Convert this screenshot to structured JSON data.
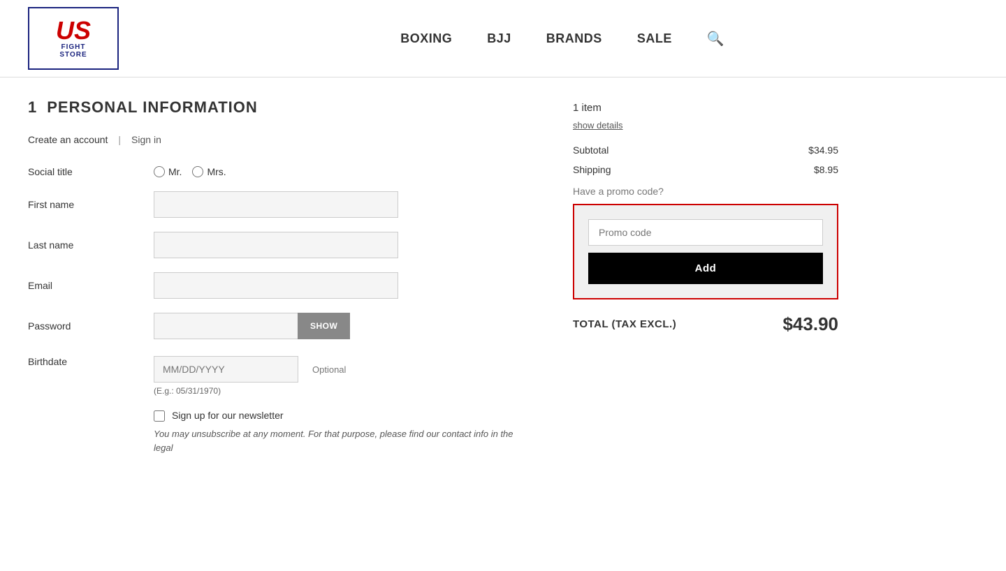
{
  "header": {
    "logo": {
      "us_text": "US",
      "fight_text": "FIGHT",
      "store_text": "STORE"
    },
    "nav": {
      "items": [
        {
          "label": "BOXING",
          "key": "boxing"
        },
        {
          "label": "BJJ",
          "key": "bjj"
        },
        {
          "label": "BRANDS",
          "key": "brands"
        },
        {
          "label": "SALE",
          "key": "sale"
        }
      ]
    }
  },
  "form": {
    "step_number": "1",
    "step_title": "PERSONAL INFORMATION",
    "create_account_label": "Create an account",
    "sign_in_label": "Sign in",
    "social_title_label": "Social title",
    "mr_label": "Mr.",
    "mrs_label": "Mrs.",
    "first_name_label": "First name",
    "first_name_placeholder": "",
    "last_name_label": "Last name",
    "last_name_placeholder": "",
    "email_label": "Email",
    "email_placeholder": "",
    "password_label": "Password",
    "password_placeholder": "",
    "show_btn_label": "SHOW",
    "birthdate_label": "Birthdate",
    "birthdate_placeholder": "MM/DD/YYYY",
    "birthdate_optional": "Optional",
    "birthdate_hint": "(E.g.: 05/31/1970)",
    "newsletter_label": "Sign up for our newsletter",
    "newsletter_note": "You may unsubscribe at any moment. For that purpose, please find our contact info in the legal"
  },
  "order_summary": {
    "items_count": "1 item",
    "show_details_label": "show details",
    "subtotal_label": "Subtotal",
    "subtotal_amount": "$34.95",
    "shipping_label": "Shipping",
    "shipping_amount": "$8.95",
    "promo_header": "Have a promo code?",
    "promo_placeholder": "Promo code",
    "add_button_label": "Add",
    "total_label": "TOTAL (TAX EXCL.)",
    "total_amount": "$43.90"
  }
}
